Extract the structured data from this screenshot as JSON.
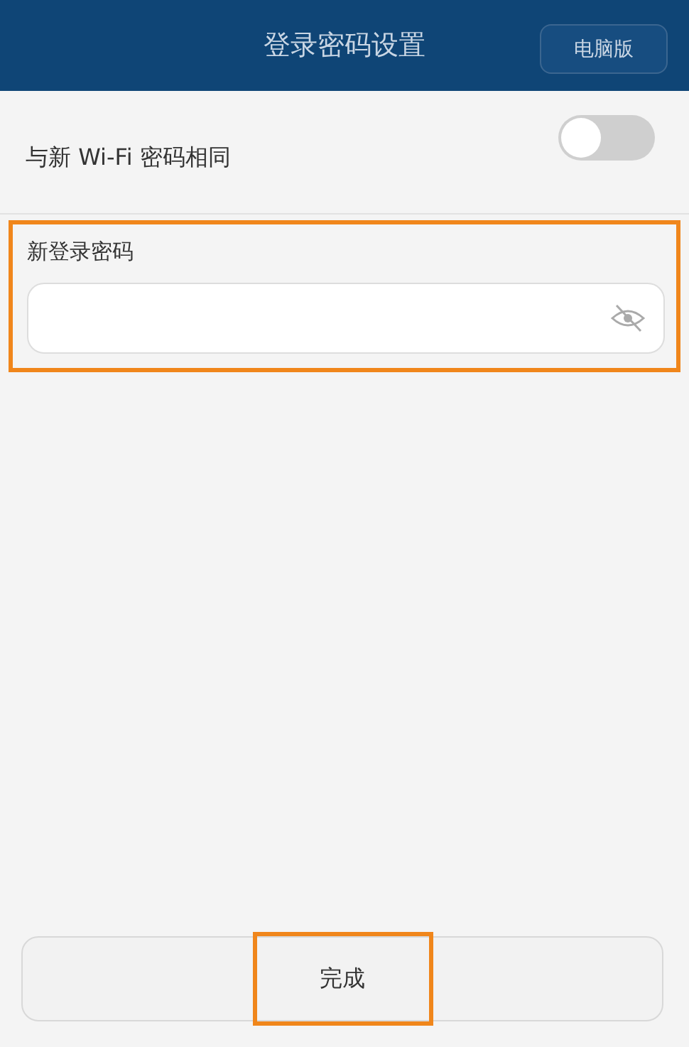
{
  "header": {
    "title": "登录密码设置",
    "action": "电脑版"
  },
  "same_as_wifi": {
    "label": "与新 Wi-Fi 密码相同",
    "on": false
  },
  "password_section": {
    "label": "新登录密码",
    "highlighted": true,
    "password_visible": false
  },
  "done_button": {
    "label": "完成",
    "highlighted": true
  }
}
